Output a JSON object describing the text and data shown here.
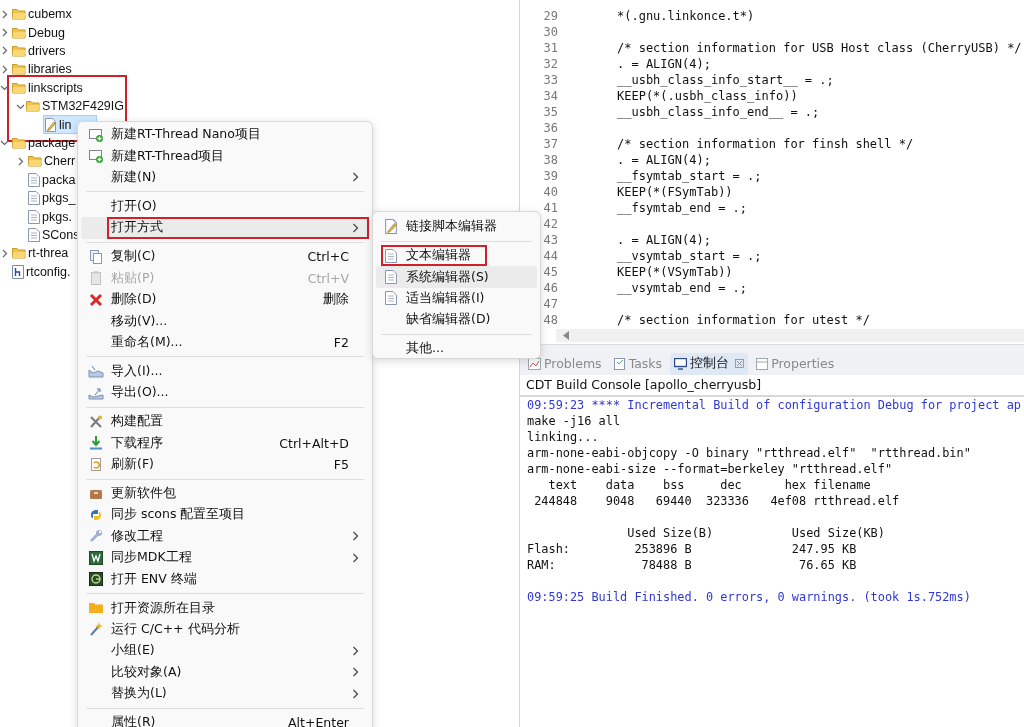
{
  "tree": [
    {
      "label": "cubemx",
      "kind": "folder",
      "expanded": false,
      "selected": false,
      "annotated": false
    },
    {
      "label": "Debug",
      "kind": "folder",
      "expanded": false,
      "selected": false,
      "annotated": false
    },
    {
      "label": "drivers",
      "kind": "folder",
      "expanded": false,
      "selected": false,
      "annotated": false
    },
    {
      "label": "libraries",
      "kind": "folder",
      "expanded": false,
      "selected": false,
      "annotated": false
    },
    {
      "label": "linkscripts",
      "kind": "folder",
      "expanded": true,
      "selected": false,
      "annotated": true,
      "children": [
        {
          "label": "STM32F429IG",
          "kind": "folder",
          "expanded": true,
          "selected": false,
          "children": [
            {
              "label": "lin",
              "kind": "script",
              "selected": true
            }
          ]
        }
      ]
    },
    {
      "label": "package",
      "kind": "folder",
      "expanded": true,
      "selected": false,
      "annotated": false,
      "children": [
        {
          "label": "Cherr",
          "kind": "folder",
          "expanded": false,
          "selected": false
        },
        {
          "label": "packa",
          "kind": "file",
          "selected": false
        },
        {
          "label": "pkgs_",
          "kind": "file",
          "selected": false
        },
        {
          "label": "pkgs.",
          "kind": "file",
          "selected": false
        },
        {
          "label": "SCons",
          "kind": "file",
          "selected": false
        }
      ]
    },
    {
      "label": "rt-threa",
      "kind": "folder",
      "expanded": false,
      "selected": false,
      "annotated": false
    },
    {
      "label": "rtconfig.",
      "kind": "header",
      "selected": false,
      "annotated": false
    }
  ],
  "menu": {
    "groups": [
      [
        {
          "label": "新建RT-Thread Nano项目",
          "submenu": false,
          "disabled": false,
          "selected": false,
          "annotated": false
        },
        {
          "label": "新建RT-Thread项目",
          "submenu": false,
          "disabled": false,
          "selected": false,
          "annotated": false
        },
        {
          "label": "新建(N)",
          "submenu": true,
          "disabled": false,
          "selected": false,
          "annotated": false
        }
      ],
      [
        {
          "label": "打开(O)",
          "submenu": false,
          "disabled": false,
          "selected": false,
          "annotated": false
        },
        {
          "label": "打开方式",
          "submenu": true,
          "disabled": false,
          "selected": true,
          "annotated": true
        }
      ],
      [
        {
          "label": "复制(C)",
          "shortcut": "Ctrl+C",
          "submenu": false,
          "disabled": false,
          "selected": false,
          "annotated": false
        },
        {
          "label": "粘贴(P)",
          "shortcut": "Ctrl+V",
          "submenu": false,
          "disabled": true,
          "selected": false,
          "annotated": false
        },
        {
          "label": "删除(D)",
          "shortcut": "删除",
          "submenu": false,
          "disabled": false,
          "selected": false,
          "annotated": false
        },
        {
          "label": "移动(V)...",
          "submenu": false,
          "disabled": false,
          "selected": false,
          "annotated": false
        },
        {
          "label": "重命名(M)...",
          "shortcut": "F2",
          "submenu": false,
          "disabled": false,
          "selected": false,
          "annotated": false
        }
      ],
      [
        {
          "label": "导入(I)...",
          "submenu": false,
          "disabled": false,
          "selected": false,
          "annotated": false
        },
        {
          "label": "导出(O)...",
          "submenu": false,
          "disabled": false,
          "selected": false,
          "annotated": false
        }
      ],
      [
        {
          "label": "构建配置",
          "submenu": false,
          "disabled": false,
          "selected": false,
          "annotated": false
        },
        {
          "label": "下载程序",
          "shortcut": "Ctrl+Alt+D",
          "submenu": false,
          "disabled": false,
          "selected": false,
          "annotated": false
        },
        {
          "label": "刷新(F)",
          "shortcut": "F5",
          "submenu": false,
          "disabled": false,
          "selected": false,
          "annotated": false
        }
      ],
      [
        {
          "label": "更新软件包",
          "submenu": false,
          "disabled": false,
          "selected": false,
          "annotated": false
        },
        {
          "label": "同步 scons 配置至项目",
          "submenu": false,
          "disabled": false,
          "selected": false,
          "annotated": false
        },
        {
          "label": "修改工程",
          "submenu": true,
          "disabled": false,
          "selected": false,
          "annotated": false
        },
        {
          "label": "同步MDK工程",
          "submenu": true,
          "disabled": false,
          "selected": false,
          "annotated": false
        },
        {
          "label": "打开 ENV 终端",
          "submenu": false,
          "disabled": false,
          "selected": false,
          "annotated": false
        }
      ],
      [
        {
          "label": "打开资源所在目录",
          "submenu": false,
          "disabled": false,
          "selected": false,
          "annotated": false
        },
        {
          "label": "运行 C/C++ 代码分析",
          "submenu": false,
          "disabled": false,
          "selected": false,
          "annotated": false
        },
        {
          "label": "小组(E)",
          "submenu": true,
          "disabled": false,
          "selected": false,
          "annotated": false
        },
        {
          "label": "比较对象(A)",
          "submenu": true,
          "disabled": false,
          "selected": false,
          "annotated": false
        },
        {
          "label": "替换为(L)",
          "submenu": true,
          "disabled": false,
          "selected": false,
          "annotated": false
        }
      ],
      [
        {
          "label": "属性(R)",
          "shortcut": "Alt+Enter",
          "submenu": false,
          "disabled": false,
          "selected": false,
          "annotated": false
        }
      ]
    ]
  },
  "submenu": {
    "groups": [
      [
        {
          "label": "链接脚本编辑器",
          "selected": false,
          "annotated": false
        }
      ],
      [
        {
          "label": "文本编辑器",
          "selected": false,
          "annotated": true
        },
        {
          "label": "系统编辑器(S)",
          "selected": true,
          "annotated": false
        },
        {
          "label": "适当编辑器(I)",
          "selected": false,
          "annotated": false
        },
        {
          "label": "缺省编辑器(D)",
          "selected": false,
          "annotated": false
        }
      ],
      [
        {
          "label": "其他...",
          "selected": false,
          "annotated": false
        }
      ]
    ]
  },
  "editor": {
    "lines": [
      {
        "number": "29",
        "code": "*(.gnu.linkonce.t*)"
      },
      {
        "number": "30"
      },
      {
        "number": "31",
        "code": "/* section information for USB Host class (CherryUSB) */"
      },
      {
        "number": "32",
        "code": ". = ALIGN(4);"
      },
      {
        "number": "33",
        "code": "__usbh_class_info_start__ = .;"
      },
      {
        "number": "34",
        "code": "KEEP(*(.usbh_class_info))"
      },
      {
        "number": "35",
        "code": "__usbh_class_info_end__ = .;"
      },
      {
        "number": "36"
      },
      {
        "number": "37",
        "code": "/* section information for finsh shell */"
      },
      {
        "number": "38",
        "code": ". = ALIGN(4);"
      },
      {
        "number": "39",
        "code": "__fsymtab_start = .;"
      },
      {
        "number": "40",
        "code": "KEEP(*(FSymTab))"
      },
      {
        "number": "41",
        "code": "__fsymtab_end = .;"
      },
      {
        "number": "42"
      },
      {
        "number": "43",
        "code": ". = ALIGN(4);"
      },
      {
        "number": "44",
        "code": "__vsymtab_start = .;"
      },
      {
        "number": "45",
        "code": "KEEP(*(VSymTab))"
      },
      {
        "number": "46",
        "code": "__vsymtab_end = .;"
      },
      {
        "number": "47"
      },
      {
        "number": "48",
        "code": "/* section information for utest */"
      }
    ]
  },
  "tabs": [
    {
      "label": "Problems",
      "selected": false,
      "closable": false
    },
    {
      "label": "Tasks",
      "selected": false,
      "closable": false
    },
    {
      "label": "控制台",
      "selected": true,
      "closable": true
    },
    {
      "label": "Properties",
      "selected": false,
      "closable": false
    }
  ],
  "console": {
    "title": "CDT Build Console [apollo_cherryusb]",
    "lines": [
      {
        "kind": "info",
        "text": "09:59:23 **** Incremental Build of configuration Debug for project ap"
      },
      {
        "kind": "plain",
        "text": "make -j16 all"
      },
      {
        "kind": "plain",
        "text": "linking..."
      },
      {
        "kind": "plain",
        "text": "arm-none-eabi-objcopy -O binary \"rtthread.elf\"  \"rtthread.bin\""
      },
      {
        "kind": "plain",
        "text": "arm-none-eabi-size --format=berkeley \"rtthread.elf\""
      },
      {
        "kind": "plain",
        "text": "   text    data    bss     dec      hex filename"
      },
      {
        "kind": "plain",
        "text": " 244848    9048   69440  323336   4ef08 rtthread.elf"
      },
      {
        "kind": "blank"
      },
      {
        "kind": "plain",
        "text": "              Used Size(B)           Used Size(KB)"
      },
      {
        "kind": "plain",
        "text": "Flash:         253896 B              247.95 KB"
      },
      {
        "kind": "plain",
        "text": "RAM:            78488 B               76.65 KB"
      },
      {
        "kind": "blank"
      },
      {
        "kind": "info",
        "text": "09:59:25 Build Finished. 0 errors, 0 warnings. (took 1s.752ms)"
      }
    ]
  }
}
